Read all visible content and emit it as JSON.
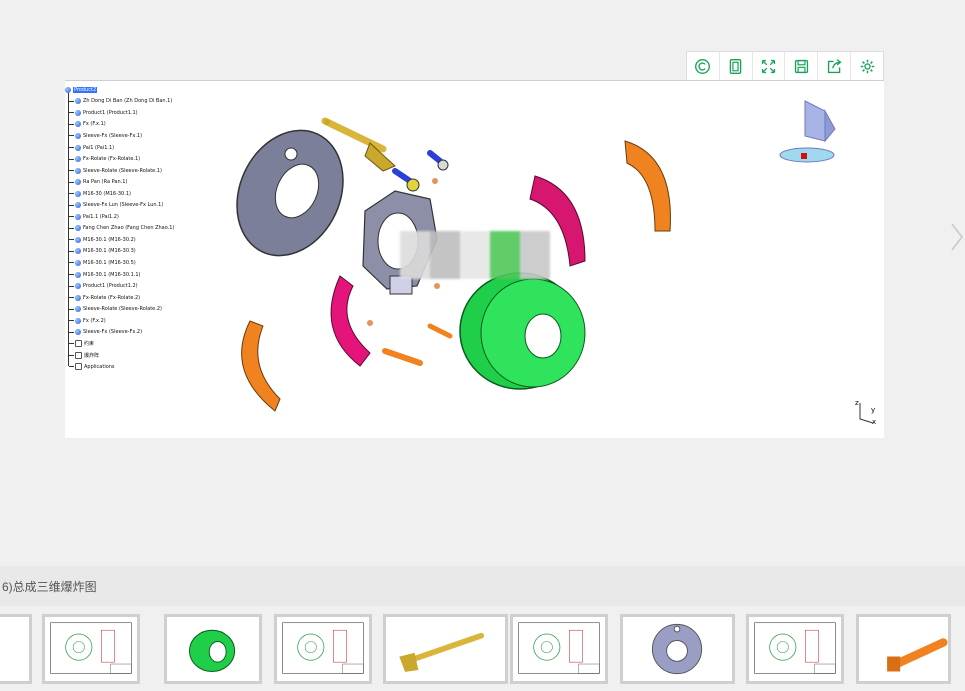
{
  "toolbar": {
    "buttons": [
      {
        "icon": "copyright-icon"
      },
      {
        "icon": "page-icon"
      },
      {
        "icon": "fullscreen-icon"
      },
      {
        "icon": "save-icon"
      },
      {
        "icon": "share-icon"
      },
      {
        "icon": "settings-icon"
      }
    ],
    "accent": "#1aa35b"
  },
  "tree": {
    "items": [
      {
        "label": "Product2",
        "root": true
      },
      {
        "label": "Zh Dong Di Ban (Zh Dong Di Ban.1)"
      },
      {
        "label": "Product1 (Product1.1)"
      },
      {
        "label": "Fx (F.x.1)"
      },
      {
        "label": "Sleeve-Fx (Sleeve-Fx.1)"
      },
      {
        "label": "Pai1 (Pai1.1)"
      },
      {
        "label": "Fx-Rolate (Fx-Rolate.1)"
      },
      {
        "label": "Sleeve-Rolate (Sleeve-Rolate.1)"
      },
      {
        "label": "Ra Pan (Ra Pan.1)"
      },
      {
        "label": "M16-30 (M16-30.1)"
      },
      {
        "label": "Sleeve-Fx Lun (Sleeve-Fx Lun.1)"
      },
      {
        "label": "Pai1.1 (Pai1.2)"
      },
      {
        "label": "Fang Chen Zhao (Fang Chen Zhao.1)"
      },
      {
        "label": "M16-30.1 (M16-30.2)"
      },
      {
        "label": "M16-30.1 (M16-30.3)"
      },
      {
        "label": "M16-30.1 (M16-30.5)"
      },
      {
        "label": "M16-30.1 (M16-30.1.1)"
      },
      {
        "label": "Product1 (Product1.2)"
      },
      {
        "label": "Fx-Rolate (Fx-Rolate.2)"
      },
      {
        "label": "Sleeve-Rolate (Sleeve-Rolate.2)"
      },
      {
        "label": "Fx (F.x.2)"
      },
      {
        "label": "Sleeve-Fx (Sleeve-Fx.2)"
      },
      {
        "label": "约束",
        "plain": true
      },
      {
        "label": "爆炸阵",
        "plain": true
      },
      {
        "label": "Applications",
        "plain": true
      }
    ]
  },
  "viewer": {
    "axis_labels": {
      "z": "z",
      "y": "y",
      "x": "x"
    }
  },
  "caption": "6)总成三维爆炸图",
  "thumbnails": [
    {
      "kind": "blank"
    },
    {
      "kind": "drawing"
    },
    {
      "kind": "green-drum"
    },
    {
      "kind": "drawing"
    },
    {
      "kind": "gold-shaft"
    },
    {
      "kind": "drawing"
    },
    {
      "kind": "gray-disc"
    },
    {
      "kind": "drawing"
    },
    {
      "kind": "orange-pin"
    }
  ]
}
